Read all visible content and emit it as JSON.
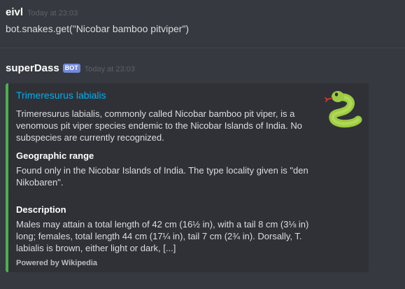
{
  "messages": {
    "first": {
      "username": "eivl",
      "timestamp": "Today at 23:03",
      "content": "bot.snakes.get(\"Nicobar bamboo pitviper\")"
    },
    "second": {
      "username": "superDass",
      "badge": "BOT",
      "timestamp": "Today at 23:03",
      "embed": {
        "accent_color": "#4caf50",
        "title": "Trimeresurus labialis",
        "description": "Trimeresurus labialis, commonly called Nicobar bamboo pit viper, is a venomous pit viper species endemic to the Nicobar Islands of India. No subspecies are currently recognized.",
        "fields": [
          {
            "name": "Geographic range",
            "value": "Found only in the Nicobar Islands of India. The type locality given is \"den Nikobaren\"."
          },
          {
            "name": "Description",
            "value": "Males may attain a total length of 42 cm (16½ in), with a tail 8 cm (3⅛ in) long; females, total length 44 cm (17¼ in), tail 7 cm (2¾ in). Dorsally, T. labialis is brown, either light or dark, [...]"
          }
        ],
        "footer": "Powered by Wikipedia",
        "thumbnail_icon": "snake-icon"
      }
    }
  },
  "colors": {
    "background": "#36393f",
    "embed_background": "#2f3136",
    "link": "#00b0f4",
    "bot_badge": "#7289da"
  }
}
